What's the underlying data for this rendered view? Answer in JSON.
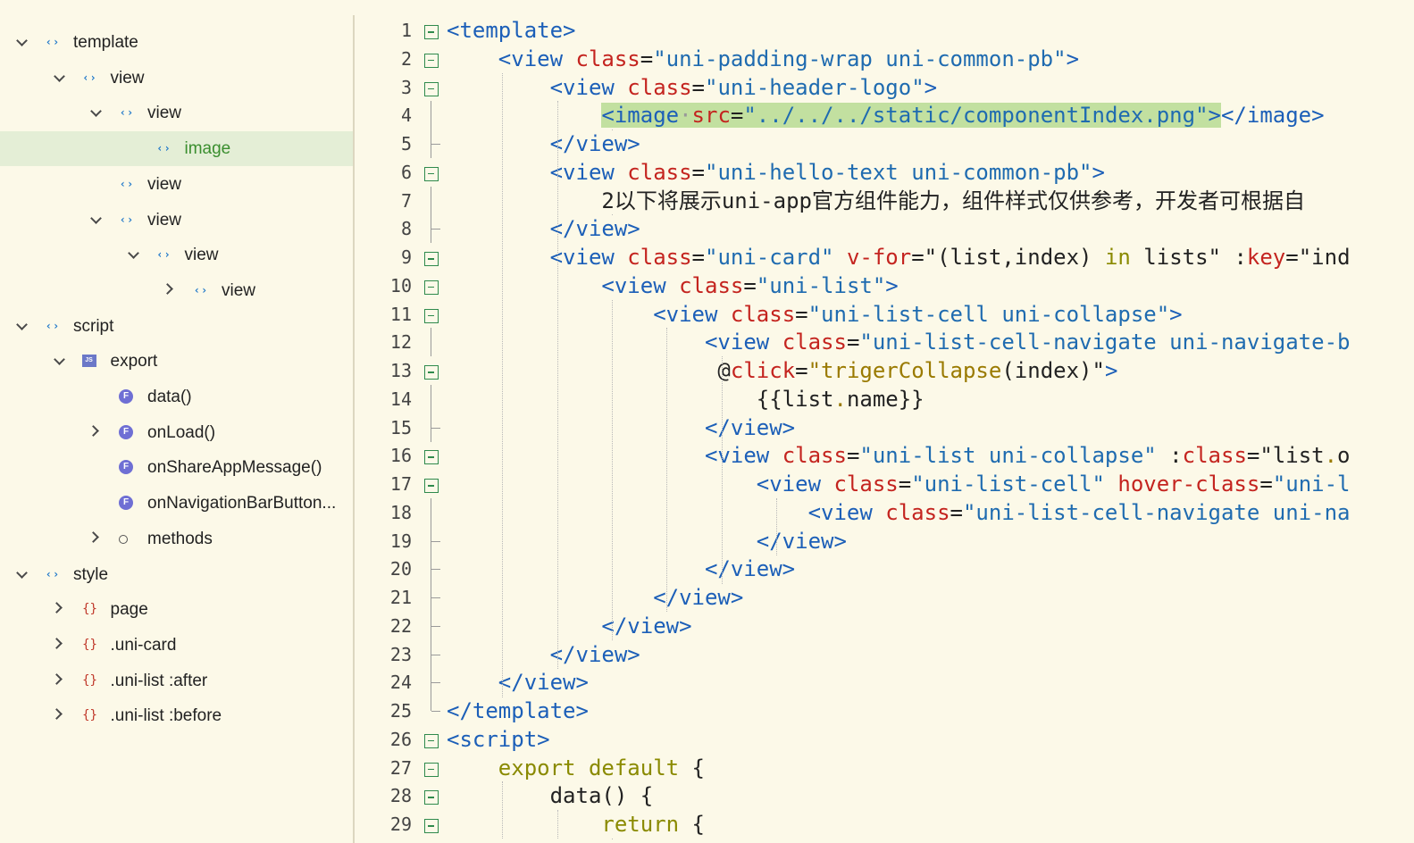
{
  "outline": {
    "items": [
      {
        "label": "template",
        "icon": "tag-icon",
        "chevron": "down"
      },
      {
        "label": "view",
        "icon": "tag-icon",
        "chevron": "down"
      },
      {
        "label": "view",
        "icon": "tag-icon",
        "chevron": "down"
      },
      {
        "label": "image",
        "icon": "tag-icon",
        "chevron": "",
        "selected": true
      },
      {
        "label": "view",
        "icon": "tag-icon",
        "chevron": ""
      },
      {
        "label": "view",
        "icon": "tag-icon",
        "chevron": "down"
      },
      {
        "label": "view",
        "icon": "tag-icon",
        "chevron": "down"
      },
      {
        "label": "view",
        "icon": "tag-icon",
        "chevron": "right"
      },
      {
        "label": "script",
        "icon": "tag-icon",
        "chevron": "down"
      },
      {
        "label": "export",
        "icon": "js-icon",
        "chevron": "down"
      },
      {
        "label": "data()",
        "icon": "function-icon",
        "chevron": ""
      },
      {
        "label": "onLoad()",
        "icon": "function-icon",
        "chevron": "right"
      },
      {
        "label": "onShareAppMessage()",
        "icon": "function-icon",
        "chevron": ""
      },
      {
        "label": "onNavigationBarButton...",
        "icon": "function-icon",
        "chevron": ""
      },
      {
        "label": "methods",
        "icon": "circle-icon",
        "chevron": "right"
      },
      {
        "label": "style",
        "icon": "tag-icon",
        "chevron": "down"
      },
      {
        "label": "page",
        "icon": "braces-icon",
        "chevron": "right"
      },
      {
        "label": ".uni-card",
        "icon": "braces-icon",
        "chevron": "right"
      },
      {
        "label": ".uni-list :after",
        "icon": "braces-icon",
        "chevron": "right"
      },
      {
        "label": ".uni-list :before",
        "icon": "braces-icon",
        "chevron": "right"
      }
    ],
    "icon_glyphs": {
      "tag-icon": "‹›",
      "js-icon": "JS",
      "function-icon": "F",
      "circle-icon": "",
      "braces-icon": "{}"
    }
  },
  "editor": {
    "lines": [
      {
        "n": "1",
        "fold": "open",
        "tokens": [
          [
            "t",
            "<template>"
          ]
        ]
      },
      {
        "n": "2",
        "fold": "open",
        "tokens": [
          [
            "p",
            "    "
          ],
          [
            "t",
            "<view "
          ],
          [
            "a",
            "class"
          ],
          [
            "p",
            "="
          ],
          [
            "s",
            "\"uni-padding-wrap uni-common-pb\""
          ],
          [
            "t",
            ">"
          ]
        ]
      },
      {
        "n": "3",
        "fold": "open",
        "tokens": [
          [
            "p",
            "        "
          ],
          [
            "t",
            "<view "
          ],
          [
            "a",
            "class"
          ],
          [
            "p",
            "="
          ],
          [
            "s",
            "\"uni-header-logo\""
          ],
          [
            "t",
            ">"
          ]
        ]
      },
      {
        "n": "4",
        "fold": "line",
        "tokens": [
          [
            "p",
            "            "
          ],
          [
            "t hl",
            "<image"
          ],
          [
            "d hl",
            "·"
          ],
          [
            "a hl",
            "src"
          ],
          [
            "p hl",
            "="
          ],
          [
            "s hl",
            "\"../../../static/componentIndex.png\""
          ],
          [
            "t hl",
            ">"
          ],
          [
            "t",
            "</image>"
          ]
        ]
      },
      {
        "n": "5",
        "fold": "end",
        "tokens": [
          [
            "p",
            "        "
          ],
          [
            "t",
            "</view>"
          ]
        ]
      },
      {
        "n": "6",
        "fold": "open",
        "tokens": [
          [
            "p",
            "        "
          ],
          [
            "t",
            "<view "
          ],
          [
            "a",
            "class"
          ],
          [
            "p",
            "="
          ],
          [
            "s",
            "\"uni-hello-text uni-common-pb\""
          ],
          [
            "t",
            ">"
          ]
        ]
      },
      {
        "n": "7",
        "fold": "line",
        "tokens": [
          [
            "p",
            "            2以下将展示uni-app官方组件能力，组件样式仅供参考，开发者可根据自"
          ]
        ]
      },
      {
        "n": "8",
        "fold": "end",
        "tokens": [
          [
            "p",
            "        "
          ],
          [
            "t",
            "</view>"
          ]
        ]
      },
      {
        "n": "9",
        "fold": "open",
        "tokens": [
          [
            "p",
            "        "
          ],
          [
            "t",
            "<view "
          ],
          [
            "a",
            "class"
          ],
          [
            "p",
            "="
          ],
          [
            "s",
            "\"uni-card\""
          ],
          [
            "p",
            " "
          ],
          [
            "a",
            "v-for"
          ],
          [
            "p",
            "=\"(list,index) "
          ],
          [
            "k",
            "in"
          ],
          [
            "p",
            " lists\" :"
          ],
          [
            "a",
            "key"
          ],
          [
            "p",
            "=\"ind"
          ]
        ]
      },
      {
        "n": "10",
        "fold": "open",
        "tokens": [
          [
            "p",
            "            "
          ],
          [
            "t",
            "<view "
          ],
          [
            "a",
            "class"
          ],
          [
            "p",
            "="
          ],
          [
            "s",
            "\"uni-list\""
          ],
          [
            "t",
            ">"
          ]
        ]
      },
      {
        "n": "11",
        "fold": "open",
        "tokens": [
          [
            "p",
            "                "
          ],
          [
            "t",
            "<view "
          ],
          [
            "a",
            "class"
          ],
          [
            "p",
            "="
          ],
          [
            "s",
            "\"uni-list-cell uni-collapse\""
          ],
          [
            "t",
            ">"
          ]
        ]
      },
      {
        "n": "12",
        "fold": "line",
        "tokens": [
          [
            "p",
            "                    "
          ],
          [
            "t",
            "<view "
          ],
          [
            "a",
            "class"
          ],
          [
            "p",
            "="
          ],
          [
            "s",
            "\"uni-list-cell-navigate uni-navigate-b"
          ]
        ]
      },
      {
        "n": "13",
        "fold": "open",
        "tokens": [
          [
            "p",
            "                     @"
          ],
          [
            "a",
            "click"
          ],
          [
            "p",
            "="
          ],
          [
            "m",
            "\"trigerCollapse"
          ],
          [
            "p",
            "(index)\""
          ],
          [
            "t",
            ">"
          ]
        ]
      },
      {
        "n": "14",
        "fold": "line",
        "tokens": [
          [
            "p",
            "                        {{list"
          ],
          [
            "m",
            "."
          ],
          [
            "p",
            "name}}"
          ]
        ]
      },
      {
        "n": "15",
        "fold": "end",
        "tokens": [
          [
            "p",
            "                    "
          ],
          [
            "t",
            "</view>"
          ]
        ]
      },
      {
        "n": "16",
        "fold": "open",
        "tokens": [
          [
            "p",
            "                    "
          ],
          [
            "t",
            "<view "
          ],
          [
            "a",
            "class"
          ],
          [
            "p",
            "="
          ],
          [
            "s",
            "\"uni-list uni-collapse\""
          ],
          [
            "p",
            " :"
          ],
          [
            "a",
            "class"
          ],
          [
            "p",
            "=\"list"
          ],
          [
            "m",
            "."
          ],
          [
            "p",
            "o"
          ]
        ]
      },
      {
        "n": "17",
        "fold": "open",
        "tokens": [
          [
            "p",
            "                        "
          ],
          [
            "t",
            "<view "
          ],
          [
            "a",
            "class"
          ],
          [
            "p",
            "="
          ],
          [
            "s",
            "\"uni-list-cell\""
          ],
          [
            "p",
            " "
          ],
          [
            "a",
            "hover-class"
          ],
          [
            "p",
            "="
          ],
          [
            "s",
            "\"uni-l"
          ]
        ]
      },
      {
        "n": "18",
        "fold": "line",
        "tokens": [
          [
            "p",
            "                            "
          ],
          [
            "t",
            "<view "
          ],
          [
            "a",
            "class"
          ],
          [
            "p",
            "="
          ],
          [
            "s",
            "\"uni-list-cell-navigate uni-na"
          ]
        ]
      },
      {
        "n": "19",
        "fold": "end",
        "tokens": [
          [
            "p",
            "                        "
          ],
          [
            "t",
            "</view>"
          ]
        ]
      },
      {
        "n": "20",
        "fold": "end",
        "tokens": [
          [
            "p",
            "                    "
          ],
          [
            "t",
            "</view>"
          ]
        ]
      },
      {
        "n": "21",
        "fold": "end",
        "tokens": [
          [
            "p",
            "                "
          ],
          [
            "t",
            "</view>"
          ]
        ]
      },
      {
        "n": "22",
        "fold": "end",
        "tokens": [
          [
            "p",
            "            "
          ],
          [
            "t",
            "</view>"
          ]
        ]
      },
      {
        "n": "23",
        "fold": "end",
        "tokens": [
          [
            "p",
            "        "
          ],
          [
            "t",
            "</view>"
          ]
        ]
      },
      {
        "n": "24",
        "fold": "end",
        "tokens": [
          [
            "p",
            "    "
          ],
          [
            "t",
            "</view>"
          ]
        ]
      },
      {
        "n": "25",
        "fold": "close",
        "tokens": [
          [
            "t",
            "</template>"
          ]
        ]
      },
      {
        "n": "26",
        "fold": "open",
        "tokens": [
          [
            "t",
            "<script>"
          ]
        ]
      },
      {
        "n": "27",
        "fold": "open",
        "tokens": [
          [
            "p",
            "    "
          ],
          [
            "k",
            "export default"
          ],
          [
            "p",
            " {"
          ]
        ]
      },
      {
        "n": "28",
        "fold": "open",
        "tokens": [
          [
            "p",
            "        data() {"
          ]
        ]
      },
      {
        "n": "29",
        "fold": "open",
        "tokens": [
          [
            "p",
            "            "
          ],
          [
            "k",
            "return"
          ],
          [
            "p",
            " {"
          ]
        ]
      }
    ]
  }
}
